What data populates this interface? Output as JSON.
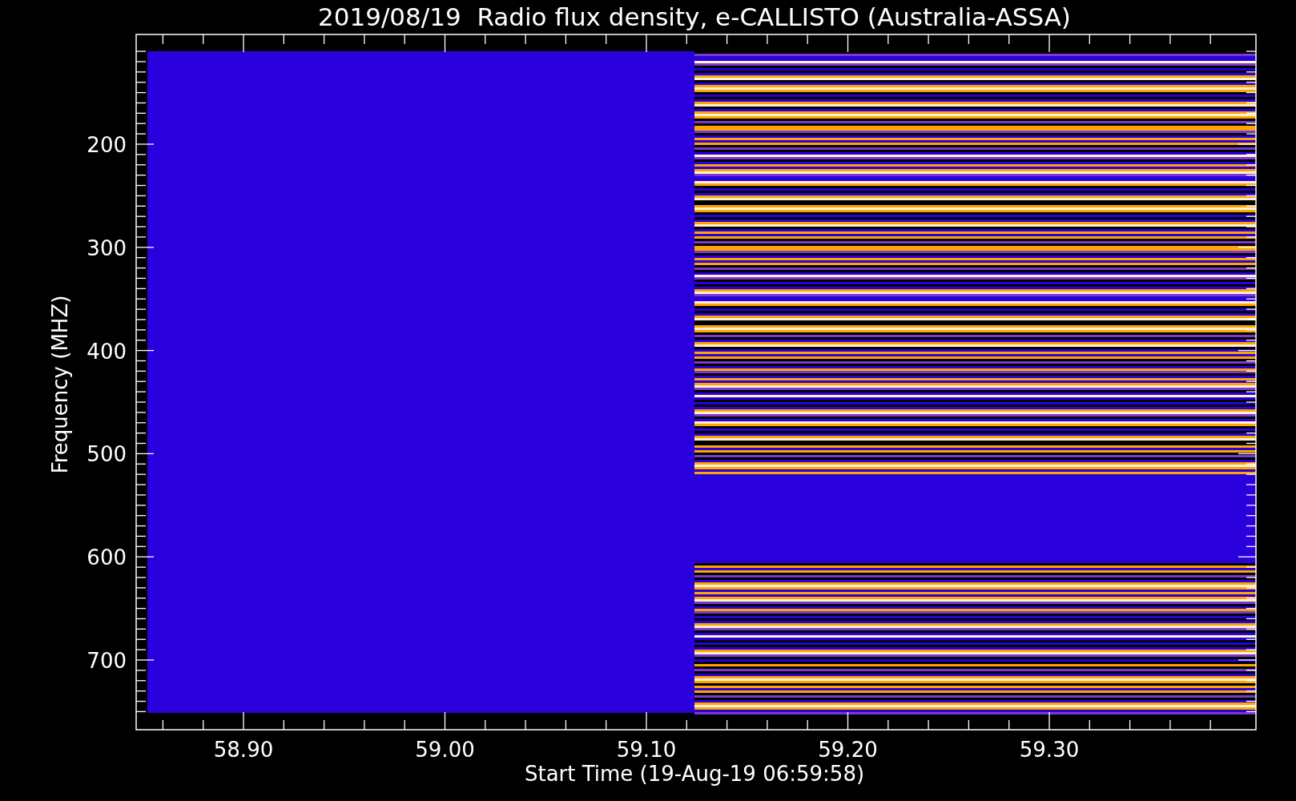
{
  "title": "2019/08/19  Radio flux density, e-CALLISTO (Australia-ASSA)",
  "y_axis": {
    "label": "Frequency (MHZ)",
    "ticks": [
      "200",
      "300",
      "400",
      "500",
      "600",
      "700"
    ]
  },
  "x_axis": {
    "label": "Start Time (19-Aug-19 06:59:58)",
    "ticks": [
      "58.90",
      "59.00",
      "59.10",
      "59.20",
      "59.30"
    ]
  }
}
